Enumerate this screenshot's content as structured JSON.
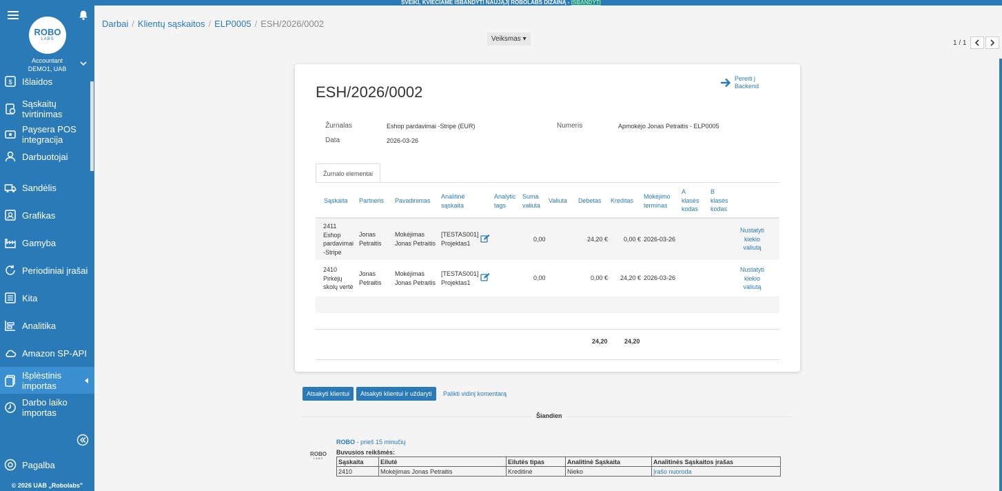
{
  "banner": {
    "text": "SVEIKI, KVIEČIAME IŠBANDYTI NAUJĄJĮ ROBOLABS DIZAINĄ -",
    "link": "IŠBANDYTI"
  },
  "sidebar": {
    "logo": {
      "top": "ROBO",
      "bottom": "LABS"
    },
    "account_role": "Accountant",
    "account_company": "DEMO1, UAB",
    "items": [
      {
        "label": "Išlaidos",
        "icon": "expenses-icon"
      },
      {
        "label": "Sąskaitų tvirtinimas",
        "icon": "invoice-approval-icon"
      },
      {
        "label": "Paysera POS integracija",
        "icon": "pos-icon"
      },
      {
        "label": "Darbuotojai",
        "icon": "employees-icon"
      },
      {
        "label": "Sandėlis",
        "icon": "warehouse-icon"
      },
      {
        "label": "Grafikas",
        "icon": "schedule-icon"
      },
      {
        "label": "Gamyba",
        "icon": "production-icon"
      },
      {
        "label": "Periodiniai įrašai",
        "icon": "recurring-icon"
      },
      {
        "label": "Kita",
        "icon": "other-icon"
      },
      {
        "label": "Analitika",
        "icon": "analytics-icon"
      },
      {
        "label": "Amazon SP-API",
        "icon": "cloud-icon"
      },
      {
        "label": "Išplėstinis importas",
        "icon": "import-icon"
      },
      {
        "label": "Darbo laiko importas",
        "icon": "clock-icon"
      }
    ],
    "help": "Pagalba",
    "copyright": "© 2026 UAB „Robolabs\""
  },
  "breadcrumb": [
    "Darbai",
    "Klientų sąskaitos",
    "ELP0005",
    "ESH/2026/0002"
  ],
  "actions_label": "Veiksmas",
  "pager": "1 / 1",
  "doc": {
    "title": "ESH/2026/0002",
    "backend_link": [
      "Pereiti į",
      "Backend"
    ],
    "journal_label": "Žurnalas",
    "journal_value": "Eshop pardavimai -Stripe (EUR)",
    "date_label": "Data",
    "date_value": "2026-03-26",
    "number_label": "Numeris",
    "number_value": "Apmokėjo Jonas Petraitis - ELP0005",
    "tab": "Žurnalo elementai"
  },
  "table": {
    "headers": {
      "account": "Sąskaita",
      "partner": "Partneris",
      "name": "Pavadinimas",
      "analytic_account": [
        "Analitinė",
        "sąskaita"
      ],
      "analytic_tags": [
        "Analytic",
        "tags"
      ],
      "amount_currency": [
        "Suma",
        "valiuta"
      ],
      "currency": "Valiuta",
      "debit": "Debetas",
      "credit": "Kreditas",
      "due": [
        "Mokėjimo",
        "terminas"
      ],
      "a_class": [
        "A",
        "klasės",
        "kodas"
      ],
      "b_class": [
        "B",
        "klasės",
        "kodas"
      ]
    },
    "rows": [
      {
        "account": [
          "2411",
          "Eshop",
          "pardavimai",
          "-Stripe"
        ],
        "partner": [
          "Jonas",
          "Petraitis"
        ],
        "name": [
          "Mokėjimas",
          "Jonas Petraitis"
        ],
        "analytic": [
          "[TESTAS001]",
          "Projektas1"
        ],
        "amount_currency": "0,00",
        "debit": "24,20 €",
        "credit": "0,00 €",
        "due": "2026-03-26",
        "action": [
          "Nustatyti",
          "kiekio",
          "valiutą"
        ]
      },
      {
        "account": [
          "2410",
          "Pirkėjų",
          "skolų vertė"
        ],
        "partner": [
          "Jonas",
          "Petraitis"
        ],
        "name": [
          "Mokėjimas",
          "Jonas Petraitis"
        ],
        "analytic": [
          "[TESTAS001]",
          "Projektas1"
        ],
        "amount_currency": "0,00",
        "debit": "0,00 €",
        "credit": "24,20 €",
        "due": "2026-03-26",
        "action": [
          "Nustatyti",
          "kiekio",
          "valiutą"
        ]
      }
    ],
    "total_debit": "24,20",
    "total_credit": "24,20"
  },
  "buttons": {
    "reply": "Atsakyti klientui",
    "reply_close": "Atsakyti klientui ir uždaryti",
    "internal_comment": "Palikti vidinį komentarą"
  },
  "chatter": {
    "day": "Šiandien",
    "author": "ROBO",
    "time": "- prieš 15 minučių",
    "old_values": "Buvusios reikšmės:",
    "log_headers": [
      "Sąskaita",
      "Eilutė",
      "Eilutės tipas",
      "Analitinė Sąskaita",
      "Analitinės Sąskaitos įrašas"
    ],
    "log_row": [
      "2410",
      "Mokėjimas Jonas Petraitis",
      "Kreditinė",
      "Nieko",
      "Įrašo nuoroda"
    ]
  }
}
